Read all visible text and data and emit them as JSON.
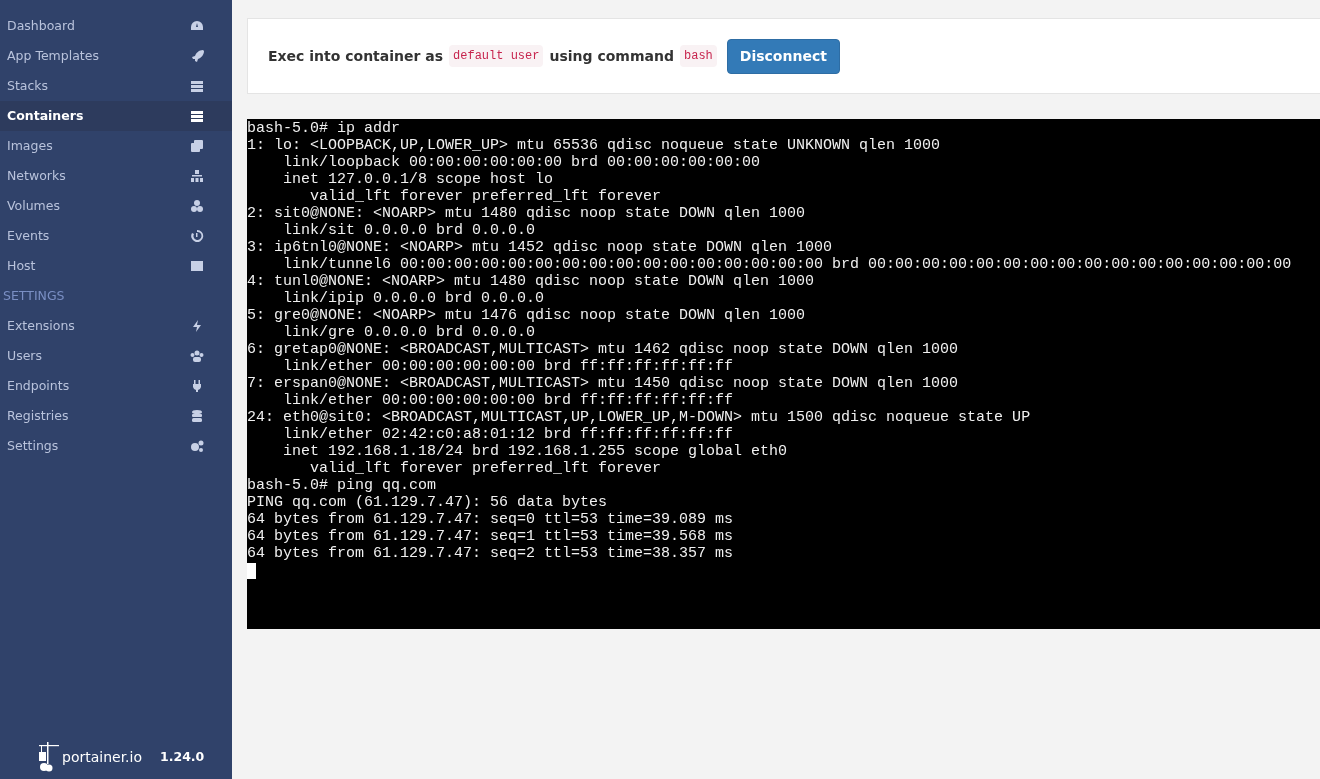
{
  "sidebar": {
    "items": [
      {
        "label": "Dashboard",
        "selected": false
      },
      {
        "label": "App Templates",
        "selected": false
      },
      {
        "label": "Stacks",
        "selected": false
      },
      {
        "label": "Containers",
        "selected": true
      },
      {
        "label": "Images",
        "selected": false
      },
      {
        "label": "Networks",
        "selected": false
      },
      {
        "label": "Volumes",
        "selected": false
      },
      {
        "label": "Events",
        "selected": false
      },
      {
        "label": "Host",
        "selected": false
      }
    ],
    "section_heading": "SETTINGS",
    "settings_items": [
      {
        "label": "Extensions",
        "selected": false
      },
      {
        "label": "Users",
        "selected": false
      },
      {
        "label": "Endpoints",
        "selected": false
      },
      {
        "label": "Registries",
        "selected": false
      },
      {
        "label": "Settings",
        "selected": false
      }
    ],
    "footer": {
      "brand": "portainer.io",
      "version": "1.24.0"
    }
  },
  "exec_panel": {
    "text_before": "Exec into container as",
    "user": "default user",
    "text_middle": "using command",
    "command": "bash",
    "button": "Disconnect"
  },
  "terminal": {
    "lines": [
      "bash-5.0# ip addr",
      "1: lo: <LOOPBACK,UP,LOWER_UP> mtu 65536 qdisc noqueue state UNKNOWN qlen 1000",
      "    link/loopback 00:00:00:00:00:00 brd 00:00:00:00:00:00",
      "    inet 127.0.0.1/8 scope host lo",
      "       valid_lft forever preferred_lft forever",
      "2: sit0@NONE: <NOARP> mtu 1480 qdisc noop state DOWN qlen 1000",
      "    link/sit 0.0.0.0 brd 0.0.0.0",
      "3: ip6tnl0@NONE: <NOARP> mtu 1452 qdisc noop state DOWN qlen 1000",
      "    link/tunnel6 00:00:00:00:00:00:00:00:00:00:00:00:00:00:00:00 brd 00:00:00:00:00:00:00:00:00:00:00:00:00:00:00:00",
      "4: tunl0@NONE: <NOARP> mtu 1480 qdisc noop state DOWN qlen 1000",
      "    link/ipip 0.0.0.0 brd 0.0.0.0",
      "5: gre0@NONE: <NOARP> mtu 1476 qdisc noop state DOWN qlen 1000",
      "    link/gre 0.0.0.0 brd 0.0.0.0",
      "6: gretap0@NONE: <BROADCAST,MULTICAST> mtu 1462 qdisc noop state DOWN qlen 1000",
      "    link/ether 00:00:00:00:00:00 brd ff:ff:ff:ff:ff:ff",
      "7: erspan0@NONE: <BROADCAST,MULTICAST> mtu 1450 qdisc noop state DOWN qlen 1000",
      "    link/ether 00:00:00:00:00:00 brd ff:ff:ff:ff:ff:ff",
      "24: eth0@sit0: <BROADCAST,MULTICAST,UP,LOWER_UP,M-DOWN> mtu 1500 qdisc noqueue state UP",
      "    link/ether 02:42:c0:a8:01:12 brd ff:ff:ff:ff:ff:ff",
      "    inet 192.168.1.18/24 brd 192.168.1.255 scope global eth0",
      "       valid_lft forever preferred_lft forever",
      "bash-5.0# ping qq.com",
      "PING qq.com (61.129.7.47): 56 data bytes",
      "64 bytes from 61.129.7.47: seq=0 ttl=53 time=39.089 ms",
      "64 bytes from 61.129.7.47: seq=1 ttl=53 time=39.568 ms",
      "64 bytes from 61.129.7.47: seq=2 ttl=53 time=38.357 ms"
    ]
  }
}
